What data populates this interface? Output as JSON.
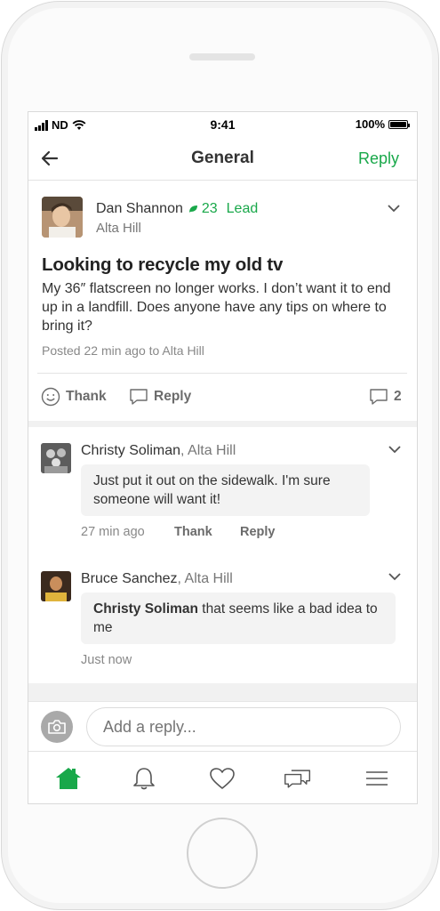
{
  "status": {
    "carrier": "ND",
    "time": "9:41",
    "battery": "100%"
  },
  "header": {
    "title": "General",
    "reply_label": "Reply"
  },
  "post": {
    "author": "Dan Shannon",
    "lead_count": "23",
    "lead_label": "Lead",
    "location": "Alta Hill",
    "title": "Looking to recycle my old tv",
    "body": "My 36″ flatscreen no longer works. I don’t want it to end up in a landfill. Does anyone have any tips on where to bring it?",
    "posted": "Posted 22 min ago to Alta Hill",
    "thank_label": "Thank",
    "reply_label": "Reply",
    "comment_count": "2"
  },
  "comments": [
    {
      "author": "Christy Soliman",
      "location": ", Alta Hill",
      "text": "Just put it out on the sidewalk. I'm sure someone will want it!",
      "time": "27 min ago",
      "thank_label": "Thank",
      "reply_label": "Reply"
    },
    {
      "author": "Bruce Sanchez",
      "location": ", Alta Hill",
      "mention": "Christy Soliman",
      "text": " that seems like a bad idea to me",
      "time": "Just now"
    }
  ],
  "composer": {
    "placeholder": "Add a reply..."
  },
  "tabs": [
    "home-icon",
    "bell-icon",
    "heart-icon",
    "chat-icon",
    "menu-icon"
  ],
  "colors": {
    "accent": "#19a84a",
    "text": "#262626",
    "muted": "#777777",
    "bubble": "#f3f3f3"
  }
}
